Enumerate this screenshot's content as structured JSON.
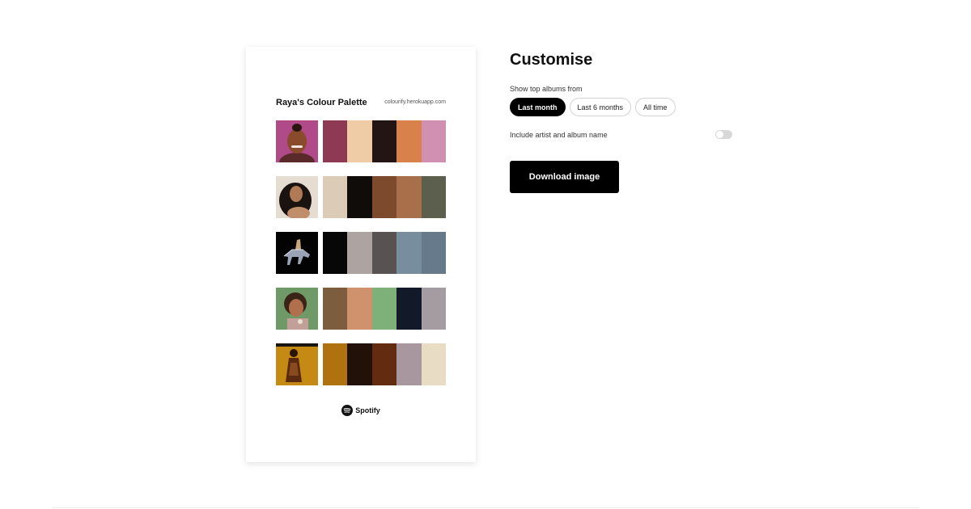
{
  "preview": {
    "title": "Raya's Colour Palette",
    "site": "colourify.herokuapp.com",
    "albums": [
      {
        "cover": "portrait-smiling-woman",
        "colors": [
          "#8E3A55",
          "#F0CCA6",
          "#241515",
          "#D9814A",
          "#D18FB2"
        ]
      },
      {
        "cover": "portrait-curly-hair",
        "colors": [
          "#DCCCB7",
          "#0F0C09",
          "#7D4A2E",
          "#A8704A",
          "#5C5F4E"
        ]
      },
      {
        "cover": "rider-on-horse",
        "colors": [
          "#070707",
          "#ADA4A1",
          "#585252",
          "#788E9E",
          "#677A8C"
        ]
      },
      {
        "cover": "portrait-green-background",
        "colors": [
          "#7C5E3E",
          "#D0926C",
          "#7EB07A",
          "#121A2A",
          "#A59CA1"
        ]
      },
      {
        "cover": "figure-orange-background",
        "colors": [
          "#B0720E",
          "#221109",
          "#632B10",
          "#A9979F",
          "#E9DCC5"
        ]
      }
    ],
    "brand": "Spotify"
  },
  "customise": {
    "heading": "Customise",
    "albums_label": "Show top albums from",
    "ranges": [
      {
        "label": "Last month",
        "active": true
      },
      {
        "label": "Last 6 months",
        "active": false
      },
      {
        "label": "All time",
        "active": false
      }
    ],
    "toggle_label": "Include artist and album name",
    "toggle_on": false,
    "download_label": "Download image"
  }
}
